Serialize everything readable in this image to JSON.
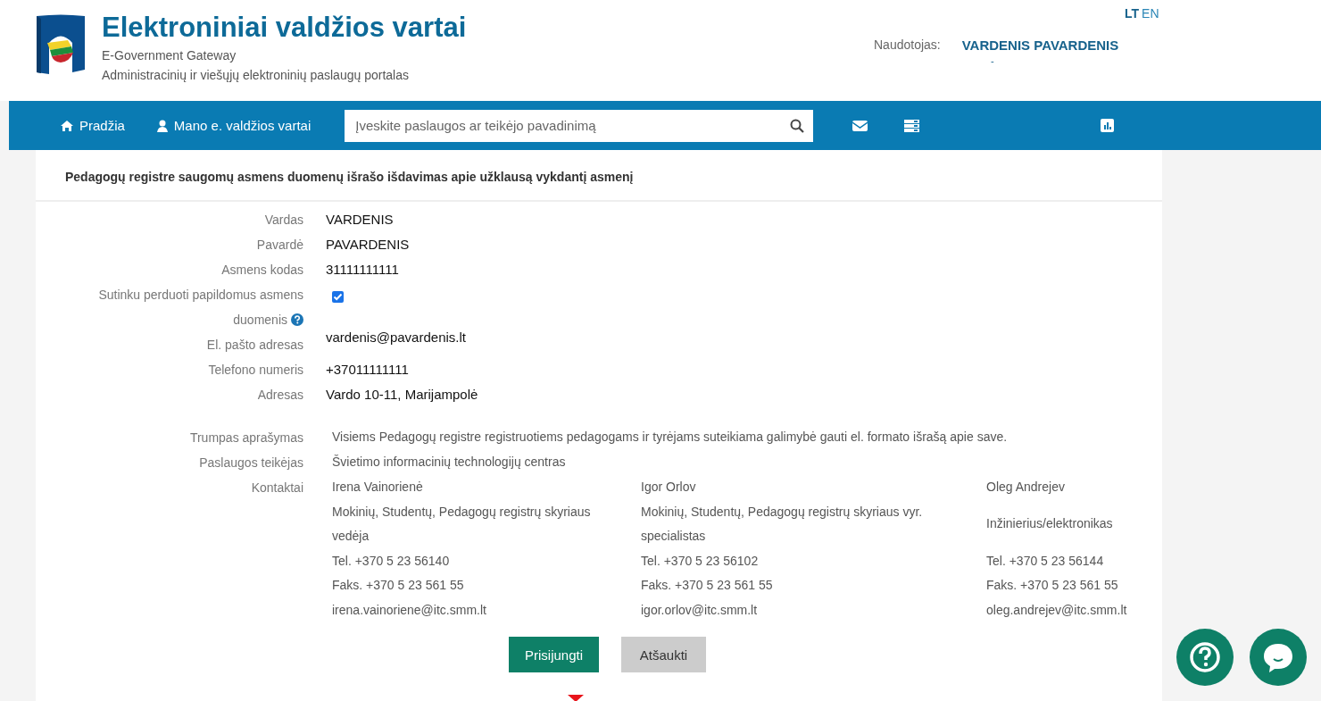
{
  "header": {
    "title": "Elektroniniai valdžios vartai",
    "subtitle": "E-Government Gateway",
    "tagline": "Administracinių ir viešųjų elektroninių paslaugų portalas",
    "languages": [
      {
        "label": "LT",
        "selected": true
      },
      {
        "label": "EN",
        "selected": false
      }
    ],
    "user_label": "Naudotojas:",
    "user_name": "VARDENIS PAVARDENIS",
    "user_extra": "-"
  },
  "nav": {
    "items": [
      {
        "label": "Pradžia",
        "kind": "home"
      },
      {
        "label": "Mano e. valdžios vartai",
        "kind": "user"
      }
    ],
    "search": {
      "placeholder": "Įveskite paslaugos ar teikėjo pavadinimą"
    },
    "icons": [
      {
        "kind": "mail"
      },
      {
        "kind": "list"
      },
      {
        "kind": "chart"
      }
    ]
  },
  "form": {
    "title": "Pedagogų registre saugomų asmens duomenų išrašo išdavimas apie užklausą vykdantį asmenį",
    "fields": [
      {
        "kind": "text",
        "label": "Vardas",
        "value": "VARDENIS"
      },
      {
        "kind": "text",
        "label": "Pavardė",
        "value": "PAVARDENIS"
      },
      {
        "kind": "text",
        "label": "Asmens kodas",
        "value": "31111111111"
      },
      {
        "kind": "checkbox",
        "label": "Sutinku perduoti papildomus asmens duomenis",
        "checked": true,
        "help": true
      },
      {
        "kind": "text",
        "label": "El. pašto adresas",
        "value": "vardenis@pavardenis.lt"
      },
      {
        "kind": "text",
        "label": "Telefono numeris",
        "value": "+37011111111"
      },
      {
        "kind": "text",
        "label": "Adresas",
        "value": "Vardo 10-11, Marijampolė"
      }
    ],
    "info": [
      {
        "label": "Trumpas aprašymas",
        "value": "Visiems Pedagogų registre registruotiems pedagogams ir tyrėjams suteikiama galimybė gauti el. formato išrašą apie save."
      },
      {
        "label": "Paslaugos teikėjas",
        "value": "Švietimo informacinių technologijų centras"
      }
    ],
    "contacts": {
      "label": "Kontaktai",
      "people": [
        {
          "name": "Irena Vainorienė",
          "position": "Mokinių, Studentų, Pedagogų registrų skyriaus vedėja",
          "phone": "Tel. +370 5 23 56140",
          "fax": "Faks. +370 5 23 561 55",
          "email": "irena.vainoriene@itc.smm.lt"
        },
        {
          "name": "Igor Orlov",
          "position": "Mokinių, Studentų, Pedagogų registrų skyriaus vyr. specialistas",
          "phone": "Tel. +370 5 23 56102",
          "fax": "Faks. +370 5 23 561 55",
          "email": "igor.orlov@itc.smm.lt"
        },
        {
          "name": "Oleg Andrejev",
          "position": "Inžinierius/elektronikas",
          "phone": "Tel. +370 5 23 56144",
          "fax": "Faks. +370 5 23 561 55",
          "email": "oleg.andrejev@itc.smm.lt"
        }
      ]
    },
    "buttons": [
      {
        "label": "Prisijungti",
        "kind": "primary"
      },
      {
        "label": "Atšaukti",
        "kind": "secondary"
      }
    ]
  },
  "floating": [
    {
      "kind": "help"
    },
    {
      "kind": "chat"
    }
  ]
}
